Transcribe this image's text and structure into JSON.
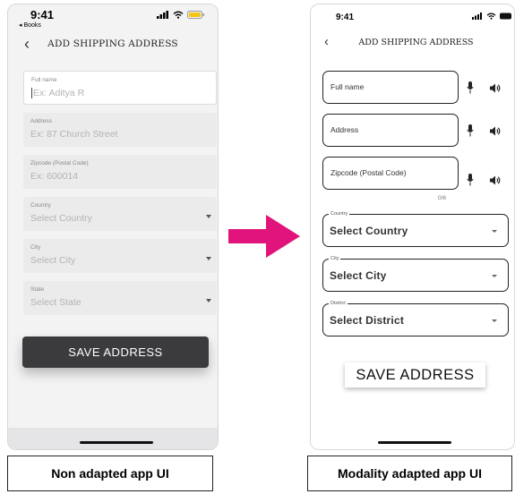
{
  "left_app": {
    "status": {
      "time": "9:41",
      "back_app": "◂ Books"
    },
    "header": {
      "back_icon": "chevron-left-icon",
      "title": "ADD SHIPPING ADDRESS"
    },
    "fields": [
      {
        "label": "Full name",
        "placeholder": "Ex: Aditya R"
      },
      {
        "label": "Address",
        "placeholder": "Ex: 87 Church Street"
      },
      {
        "label": "Zipcode (Postal Code)",
        "placeholder": "Ex: 600014"
      },
      {
        "label": "Country",
        "placeholder": "Select Country"
      },
      {
        "label": "City",
        "placeholder": "Select City"
      },
      {
        "label": "State",
        "placeholder": "Select State"
      }
    ],
    "save_label": "SAVE ADDRESS",
    "caption": "Non adapted app UI"
  },
  "right_app": {
    "status": {
      "time": "9:41"
    },
    "header": {
      "back_icon": "chevron-left-icon",
      "title": "ADD SHIPPING ADDRESS"
    },
    "text_fields": [
      {
        "label": "Full name",
        "icons": [
          "microphone-icon",
          "speaker-icon"
        ]
      },
      {
        "label": "Address",
        "icons": [
          "microphone-icon",
          "speaker-icon"
        ]
      },
      {
        "label": "Zipcode (Postal Code)",
        "icons": [
          "microphone-icon",
          "speaker-icon"
        ]
      }
    ],
    "zipcode_counter": "0/6",
    "selects": [
      {
        "floating_label": "Country",
        "value": "Select Country"
      },
      {
        "floating_label": "City",
        "value": "Select City"
      },
      {
        "floating_label": "District",
        "value": "Select District"
      }
    ],
    "save_label": "SAVE ADDRESS",
    "caption": "Modality adapted app UI"
  },
  "colors": {
    "arrow": "#e0147a",
    "left_save_bg": "#3b3a3d",
    "battery_left": "#f5c518",
    "battery_right": "#111111"
  }
}
